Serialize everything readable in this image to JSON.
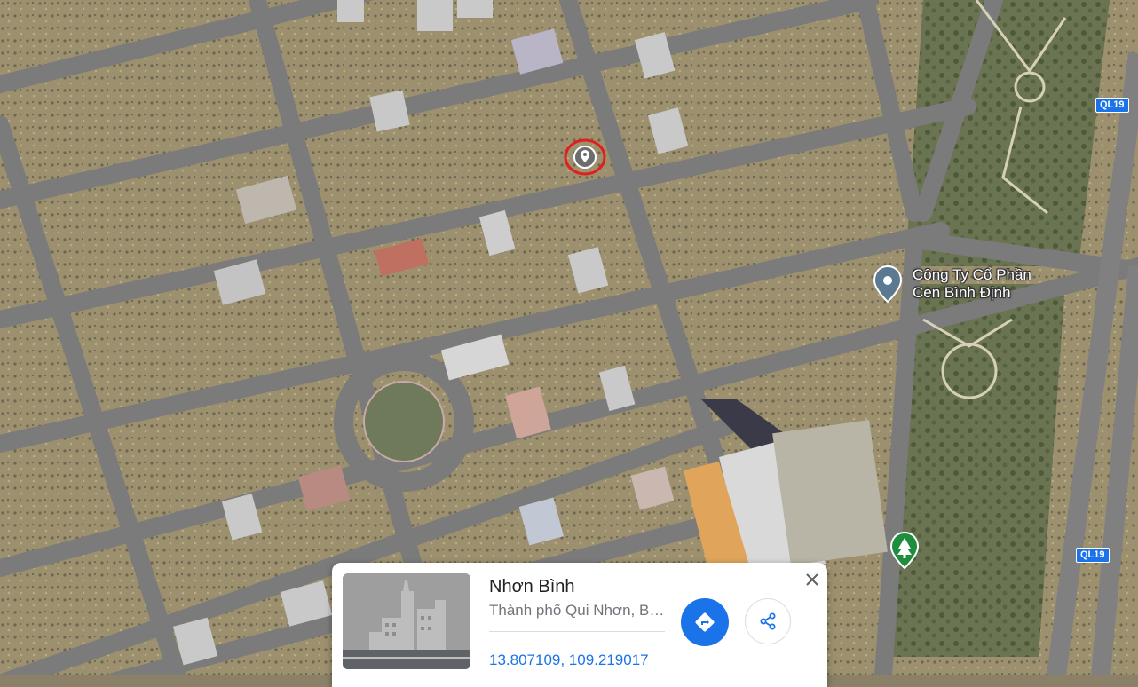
{
  "map": {
    "type": "satellite",
    "colors": {
      "ground": "#9a8e6e",
      "road": "#7d7d7d",
      "road_edge": "#6b6b6b",
      "vegetation": "#5a6a45",
      "building": "#c9c9c9",
      "marker_red": "#e0201f",
      "poi_blue": "#5b7a91",
      "park_green": "#1e8e3e"
    }
  },
  "labels": {
    "company_line1": "Công Ty Cổ Phần",
    "company_line2": "Cen Bình Định",
    "highway_top": "QL19",
    "highway_bottom": "QL19"
  },
  "markers": {
    "dropped_pin": "location-pin-icon",
    "company_poi": "place-pin-icon",
    "park_poi": "tree-icon"
  },
  "card": {
    "title": "Nhơn Bình",
    "subtitle": "Thành phố Qui Nhơn, Bình Định",
    "coordinates": "13.807109, 109.219017",
    "directions_icon": "directions-icon",
    "share_icon": "share-icon",
    "close_icon": "close-icon",
    "thumbnail_icon": "city-placeholder-icon"
  }
}
